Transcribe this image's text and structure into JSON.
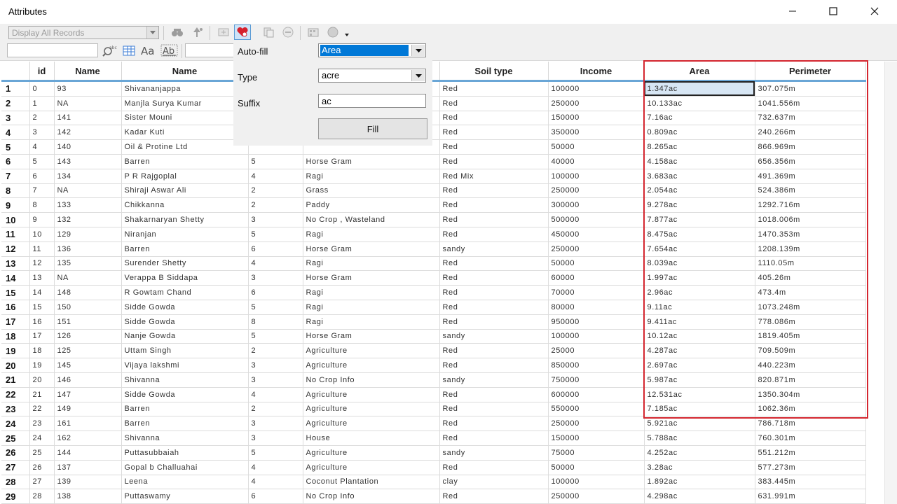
{
  "window": {
    "title": "Attributes"
  },
  "toolbar": {
    "display_select": "Display All Records",
    "icons": [
      "binoculars-icon",
      "zoom-to-icon",
      "add-record-icon",
      "autofill-icon",
      "copy-icon",
      "delete-record-icon",
      "calculator-icon",
      "options-icon"
    ],
    "row2_icons": [
      "search-abc-icon",
      "table-icon",
      "font-aa-icon",
      "label-ab-icon"
    ]
  },
  "autofill": {
    "autofill_label": "Auto-fill",
    "autofill_value": "Area",
    "type_label": "Type",
    "type_value": "acre",
    "suffix_label": "Suffix",
    "suffix_value": "ac",
    "fill_button": "Fill"
  },
  "colors": {
    "highlight_box": "#d4262f",
    "header_line": "#6aa6d6",
    "selected_cell": "#d7e6f4",
    "dropdown_selected": "#0078d7"
  },
  "grid": {
    "columns": [
      "",
      "id",
      "Name",
      "Name",
      "",
      "",
      "Soil type",
      "Income",
      "Area",
      "Perimeter"
    ],
    "rows": [
      [
        "1",
        "0",
        "93",
        "Shivananjappa",
        "",
        "",
        "Red",
        "100000",
        "1.347ac",
        "307.075m"
      ],
      [
        "2",
        "1",
        "NA",
        "Manjla Surya Kumar",
        "",
        "",
        "Red",
        "250000",
        "10.133ac",
        "1041.556m"
      ],
      [
        "3",
        "2",
        "141",
        "Sister Mouni",
        "",
        "",
        "Red",
        "150000",
        "7.16ac",
        "732.637m"
      ],
      [
        "4",
        "3",
        "142",
        "Kadar Kuti",
        "",
        "",
        "Red",
        "350000",
        "0.809ac",
        "240.266m"
      ],
      [
        "5",
        "4",
        "140",
        "Oil & Protine Ltd",
        "",
        "",
        "Red",
        "50000",
        "8.265ac",
        "866.969m"
      ],
      [
        "6",
        "5",
        "143",
        "Barren",
        "5",
        "Horse Gram",
        "Red",
        "40000",
        "4.158ac",
        "656.356m"
      ],
      [
        "7",
        "6",
        "134",
        "P R Rajgoplal",
        "4",
        "Ragi",
        "Red Mix",
        "100000",
        "3.683ac",
        "491.369m"
      ],
      [
        "8",
        "7",
        "NA",
        "Shiraji Aswar Ali",
        "2",
        "Grass",
        "Red",
        "250000",
        "2.054ac",
        "524.386m"
      ],
      [
        "9",
        "8",
        "133",
        "Chikkanna",
        "2",
        "Paddy",
        "Red",
        "300000",
        "9.278ac",
        "1292.716m"
      ],
      [
        "10",
        "9",
        "132",
        "Shakarnaryan Shetty",
        "3",
        "No Crop , Wasteland",
        "Red",
        "500000",
        "7.877ac",
        "1018.006m"
      ],
      [
        "11",
        "10",
        "129",
        "Niranjan",
        "5",
        "Ragi",
        "Red",
        "450000",
        "8.475ac",
        "1470.353m"
      ],
      [
        "12",
        "11",
        "136",
        "Barren",
        "6",
        "Horse Gram",
        "sandy",
        "250000",
        "7.654ac",
        "1208.139m"
      ],
      [
        "13",
        "12",
        "135",
        "Surender Shetty",
        "4",
        "Ragi",
        "Red",
        "50000",
        "8.039ac",
        "1110.05m"
      ],
      [
        "14",
        "13",
        "NA",
        "Verappa B Siddapa",
        "3",
        "Horse Gram",
        "Red",
        "60000",
        "1.997ac",
        "405.26m"
      ],
      [
        "15",
        "14",
        "148",
        "R Gowtam Chand",
        "6",
        "Ragi",
        "Red",
        "70000",
        "2.96ac",
        "473.4m"
      ],
      [
        "16",
        "15",
        "150",
        "Sidde Gowda",
        "5",
        "Ragi",
        "Red",
        "80000",
        "9.11ac",
        "1073.248m"
      ],
      [
        "17",
        "16",
        "151",
        "Sidde Gowda",
        "8",
        "Ragi",
        "Red",
        "950000",
        "9.411ac",
        "778.086m"
      ],
      [
        "18",
        "17",
        "126",
        "Nanje Gowda",
        "5",
        "Horse Gram",
        "sandy",
        "100000",
        "10.12ac",
        "1819.405m"
      ],
      [
        "19",
        "18",
        "125",
        "Uttam Singh",
        "2",
        "Agriculture",
        "Red",
        "25000",
        "4.287ac",
        "709.509m"
      ],
      [
        "20",
        "19",
        "145",
        "Vijaya lakshmi",
        "3",
        "Agriculture",
        "Red",
        "850000",
        "2.697ac",
        "440.223m"
      ],
      [
        "21",
        "20",
        "146",
        "Shivanna",
        "3",
        "No Crop Info",
        "sandy",
        "750000",
        "5.987ac",
        "820.871m"
      ],
      [
        "22",
        "21",
        "147",
        "Sidde Gowda",
        "4",
        "Agriculture",
        "Red",
        "600000",
        "12.531ac",
        "1350.304m"
      ],
      [
        "23",
        "22",
        "149",
        "Barren",
        "2",
        "Agriculture",
        "Red",
        "550000",
        "7.185ac",
        "1062.36m"
      ],
      [
        "24",
        "23",
        "161",
        "Barren",
        "3",
        "Agriculture",
        "Red",
        "250000",
        "5.921ac",
        "786.718m"
      ],
      [
        "25",
        "24",
        "162",
        "Shivanna",
        "3",
        "House",
        "Red",
        "150000",
        "5.788ac",
        "760.301m"
      ],
      [
        "26",
        "25",
        "144",
        "Puttasubbaiah",
        "5",
        "Agriculture",
        "sandy",
        "75000",
        "4.252ac",
        "551.212m"
      ],
      [
        "27",
        "26",
        "137",
        "Gopal b Challuahai",
        "4",
        "Agriculture",
        "Red",
        "50000",
        "3.28ac",
        "577.273m"
      ],
      [
        "28",
        "27",
        "139",
        "Leena",
        "4",
        "Coconut Plantation",
        "clay",
        "100000",
        "1.892ac",
        "383.445m"
      ],
      [
        "29",
        "28",
        "138",
        "Puttaswamy",
        "6",
        "No Crop Info",
        "Red",
        "250000",
        "4.298ac",
        "631.991m"
      ]
    ]
  }
}
